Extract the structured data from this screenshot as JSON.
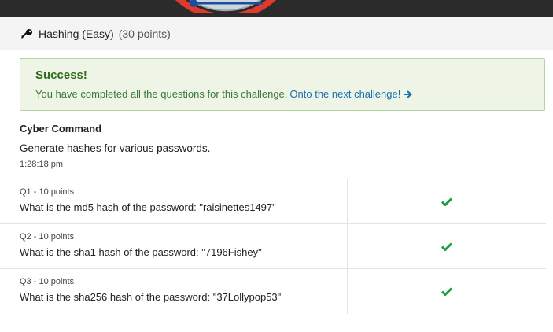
{
  "header": {
    "title": "Hashing (Easy)",
    "points": "(30 points)",
    "icon": "key-icon"
  },
  "alert": {
    "title": "Success!",
    "text": "You have completed all the questions for this challenge.",
    "link": "Onto the next challenge!",
    "color_text": "#3c763d",
    "color_link": "#1a6fb0"
  },
  "challenge": {
    "author": "Cyber Command",
    "description": "Generate hashes for various passwords.",
    "time": "1:28:18 pm"
  },
  "questions": [
    {
      "label": "Q1 - 10 points",
      "text": "What is the md5 hash of the password: \"raisinettes1497\"",
      "status": "check-icon"
    },
    {
      "label": "Q2 - 10 points",
      "text": "What is the sha1 hash of the password: \"7196Fishey\"",
      "status": "check-icon"
    },
    {
      "label": "Q3 - 10 points",
      "text": "What is the sha256 hash of the password: \"37Lollypop53\"",
      "status": "check-icon"
    }
  ],
  "colors": {
    "success": "#1e9e3e",
    "logo_red": "#e03a2f"
  }
}
